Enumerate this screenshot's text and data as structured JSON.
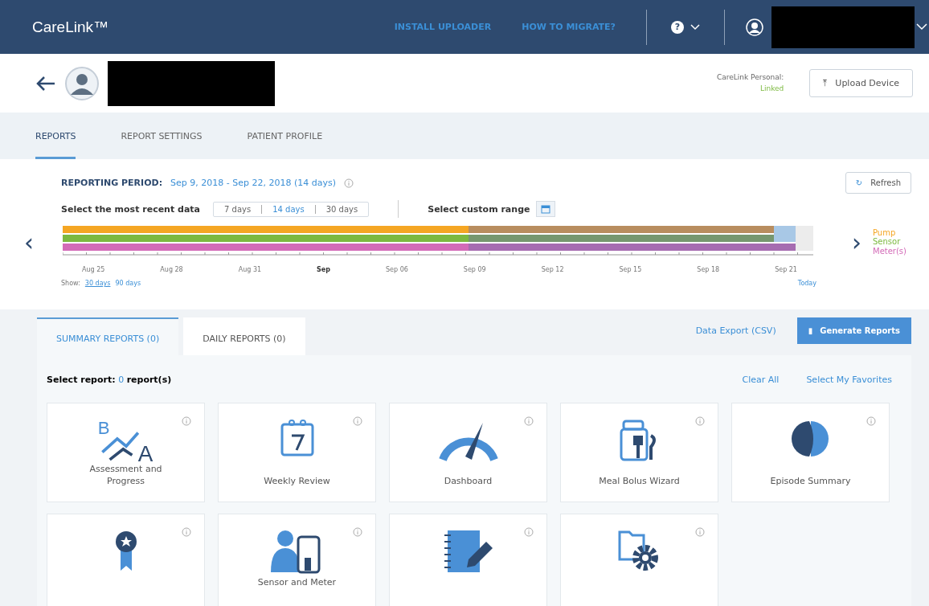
{
  "header": {
    "logo": "CareLink™",
    "links": [
      "INSTALL UPLOADER",
      "HOW TO MIGRATE?"
    ]
  },
  "patient": {
    "status_label": "CareLink Personal:",
    "status_value": "Linked",
    "upload_button": "Upload Device"
  },
  "tabs": [
    {
      "label": "REPORTS",
      "selected": true
    },
    {
      "label": "REPORT SETTINGS",
      "selected": false
    },
    {
      "label": "PATIENT PROFILE",
      "selected": false
    }
  ],
  "period": {
    "label": "REPORTING PERIOD:",
    "value": "Sep 9, 2018 - Sep 22, 2018  (14 days)",
    "refresh": "Refresh",
    "recent_label": "Select the most recent data",
    "ranges": [
      {
        "label": "7 days",
        "selected": false
      },
      {
        "label": "14 days",
        "selected": true
      },
      {
        "label": "30 days",
        "selected": false
      }
    ],
    "custom_label": "Select custom range"
  },
  "timeline": {
    "legend": [
      {
        "label": "Pump",
        "color": "#f5a623"
      },
      {
        "label": "Sensor",
        "color": "#7cb940"
      },
      {
        "label": "Meter(s)",
        "color": "#d36bb8"
      }
    ],
    "ticks": [
      {
        "label": "Aug 25",
        "bold": false
      },
      {
        "label": "Aug 28",
        "bold": false
      },
      {
        "label": "Aug 31",
        "bold": false
      },
      {
        "label": "Sep",
        "bold": true
      },
      {
        "label": "Sep 06",
        "bold": false
      },
      {
        "label": "Sep 09",
        "bold": false
      },
      {
        "label": "Sep 12",
        "bold": false
      },
      {
        "label": "Sep 15",
        "bold": false
      },
      {
        "label": "Sep 18",
        "bold": false
      },
      {
        "label": "Sep 21",
        "bold": false
      }
    ],
    "show_label": "Show:",
    "show_options": [
      {
        "label": "30 days",
        "selected": true
      },
      {
        "label": "90 days",
        "selected": false
      }
    ],
    "today": "Today"
  },
  "report_tabs": [
    {
      "label": "SUMMARY REPORTS (0)",
      "selected": true
    },
    {
      "label": "DAILY REPORTS (0)",
      "selected": false
    }
  ],
  "export_link": "Data Export (CSV)",
  "generate_button": "Generate Reports",
  "selection": {
    "label": "Select report:",
    "count": "0",
    "unit": "report(s)",
    "clear": "Clear All",
    "favorites": "Select My Favorites"
  },
  "icons": {
    "help": "?",
    "upload": "⤒",
    "refresh": "↻",
    "previous": "‹",
    "next": "›",
    "generate": "▮"
  },
  "reports": [
    {
      "kind": "assessment",
      "label": "Assessment and Progress",
      "icon_letters": [
        "B",
        "A"
      ]
    },
    {
      "kind": "weekly",
      "label": "Weekly Review"
    },
    {
      "kind": "dashboard",
      "label": "Dashboard"
    },
    {
      "kind": "meal",
      "label": "Meal Bolus Wizard"
    },
    {
      "kind": "episode",
      "label": "Episode Summary"
    },
    {
      "kind": "award"
    },
    {
      "kind": "sensor",
      "label": "Sensor and Meter"
    },
    {
      "kind": "logbook"
    },
    {
      "kind": "device"
    }
  ]
}
